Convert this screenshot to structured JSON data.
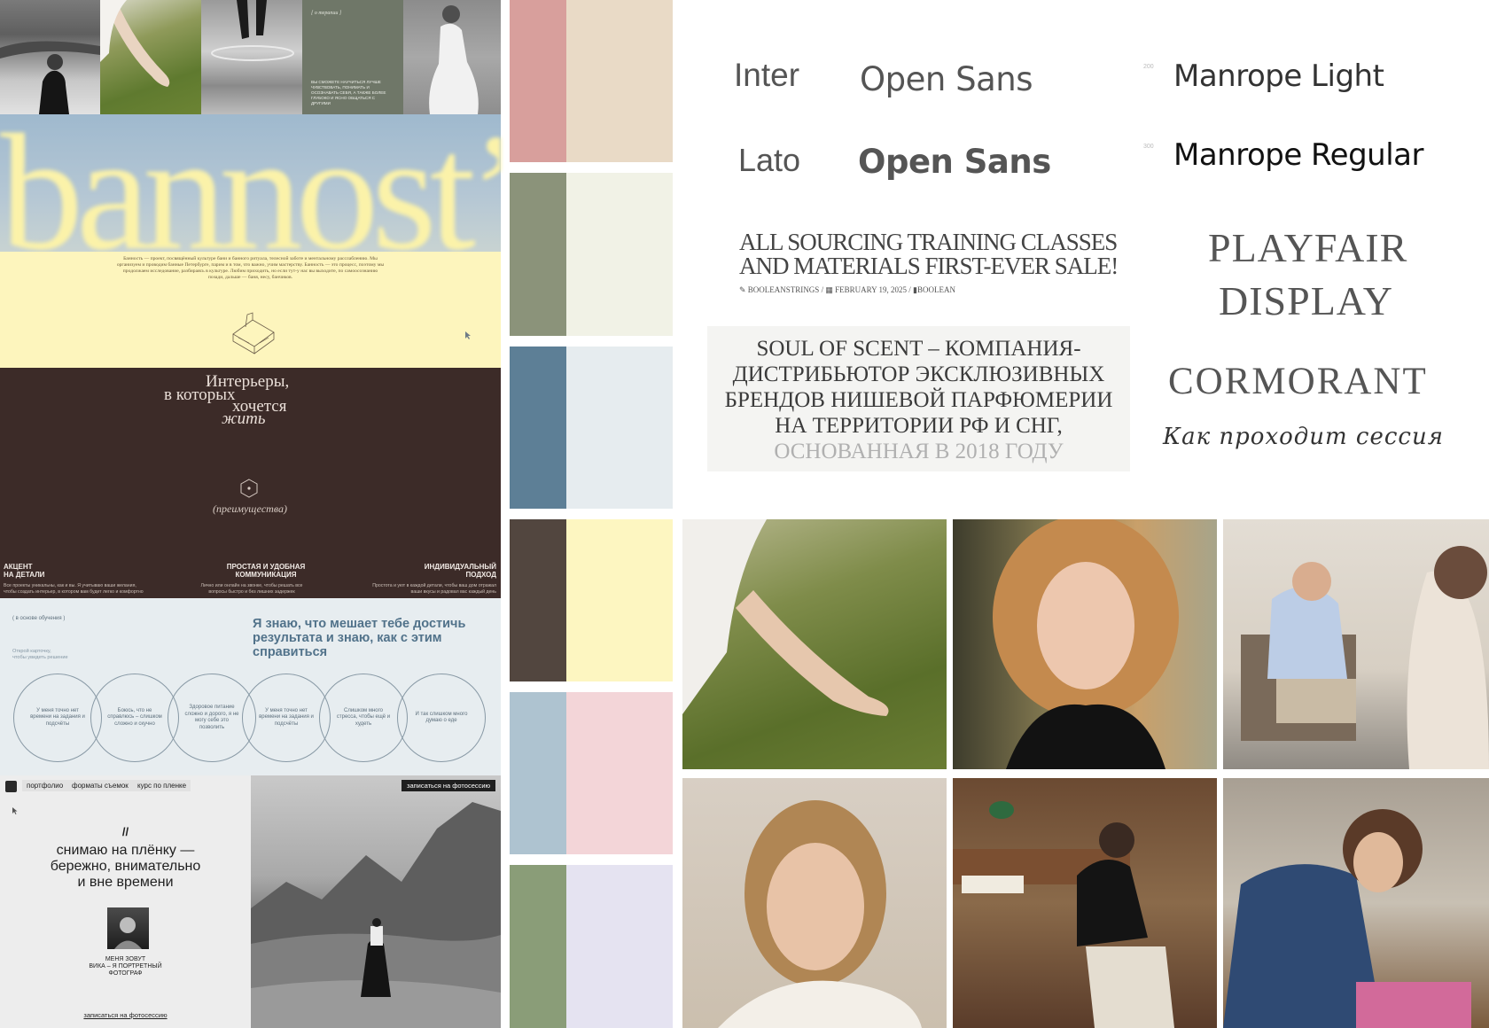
{
  "moodboard": {
    "top_strip": {
      "caption_small": "[ о терапии ]",
      "caption_body": "ВЫ СМОЖЕТЕ НАУЧИТЬСЯ ЛУЧШЕ ЧУВСТВОВАТЬ, ПОНИМАТЬ И ОСОЗНАВАТЬ СЕБЯ, А ТАКЖЕ БОЛЕЕ ГЛУБОКО И ЯСНО ОБЩАТЬСЯ С ДРУГИМИ"
    },
    "bannost": {
      "logo": "bannost’",
      "paragraph": "Банность — проект, посвящённый культуре бани и банного ритуала, телесной заботе и ментальному расслаблению. Мы организуем и проводим банные Петербурге, парим и в том, что важно, учим мастерству. Банность — это процесс, поэтому мы продолжаем исследование, разбираясь в культуре. Любим приходить, но если тут-у нас вы выходите, по самоосознанию позади, дальше — баня, несу, банчиков."
    },
    "interiors": {
      "title_line1": "Интерьеры,",
      "title_line2": "в которых",
      "title_line3": "хочется",
      "title_line4": "жить",
      "caption": "(преимущества)",
      "features": [
        {
          "title": "АКЦЕНТ\nНА ДЕТАЛИ",
          "desc": "Все проекты уникальны, как и вы. Я учитываю ваши желания, чтобы создать интерьер, в котором вам будет легко и комфортно"
        },
        {
          "title": "ПРОСТАЯ И УДОБНАЯ\nКОММУНИКАЦИЯ",
          "desc": "Лично или онлайн на звонке, чтобы решать все вопросы быстро и без лишних задержек"
        },
        {
          "title": "ИНДИВИДУАЛЬНЫЙ\nПОДХОД",
          "desc": "Простота и уют в каждой детали, чтобы ваш дом отражал ваши вкусы и радовал вас каждый день"
        }
      ]
    },
    "edu": {
      "tag": "( в основе обучения )",
      "hint": "Открой карточку,\nчтобы увидеть решение",
      "heading": "Я знаю, что мешает тебе достичь результата и знаю, как с этим справиться",
      "circles": [
        "У меня точно\nнет времени\nна задания\nи подсчёты",
        "Боюсь,\nчто не справлюсь –\nслишком сложно\nи скучно",
        "Здоровое питание\nсложно и дорого,\nя не могу себе\nэто позволить",
        "У меня точно\nнет времени\nна задания\nи подсчёты",
        "Слишком много\nстресса,\nчтобы ещё и худеть",
        "И так слишком\nмного думаю\nо еде"
      ]
    },
    "photo_site": {
      "nav": [
        "портфолио",
        "форматы съемок",
        "курс по пленке"
      ],
      "cta_top": "записаться на фотосессию",
      "mark": "//",
      "headline_1": "снимаю на плёнку —",
      "headline_2": "бережно, внимательно",
      "headline_3": "и вне времени",
      "intro_1": "МЕНЯ ЗОВУТ",
      "intro_2": "ВИКА – Я ПОРТРЕТНЫЙ",
      "intro_3": "ФОТОГРАФ",
      "cta_bottom": "записаться на фотосессию"
    },
    "palette": [
      [
        "#d89f9c",
        "#e9dac6"
      ],
      [
        "#8b937a",
        "#f1f2e6"
      ],
      [
        "#5d7f96",
        "#e6ecef"
      ],
      [
        "#52463f",
        "#fdf6c1"
      ],
      [
        "#aec3d0",
        "#f3d5d8"
      ],
      [
        "#8a9d78",
        "#e5e3f1"
      ]
    ],
    "fonts": {
      "inter": "Inter",
      "open_sans_light": "Open Sans",
      "lato": "Lato",
      "open_sans_bold": "Open Sans",
      "manrope_light_weight": "200",
      "manrope_light": "Manrope Light",
      "manrope_regular_weight": "300",
      "manrope_regular": "Manrope Regular",
      "sale_line1": "ALL SOURCING TRAINING CLASSES",
      "sale_line2": "AND MATERIALS FIRST-EVER SALE!",
      "sale_meta_author": "BOOLEANSTRINGS",
      "sale_meta_date": "FEBRUARY 19, 2025",
      "sale_meta_cat": "BOOLEAN",
      "playfair_1": "PLAYFAIR",
      "playfair_2": "DISPLAY",
      "soul_line1": "SOUL OF SCENT – КОМПАНИЯ-",
      "soul_line2": "ДИСТРИБЬЮТОР ЭКСКЛЮЗИВНЫХ",
      "soul_line3": "БРЕНДОВ НИШЕВОЙ ПАРФЮМЕРИИ",
      "soul_line4": "НА ТЕРРИТОРИИ РФ И СНГ,",
      "soul_line5": "ОСНОВАННАЯ В 2018 ГОДУ",
      "cormorant": "CORMORANT",
      "script": "Как проходит сессия"
    },
    "colors": {
      "bannost_yellow": "#fdf5bd",
      "interiors_brown": "#3c2b28",
      "edu_bg": "#e7edf0",
      "edu_heading": "#51728a",
      "specimen_gray": "#555555"
    }
  }
}
